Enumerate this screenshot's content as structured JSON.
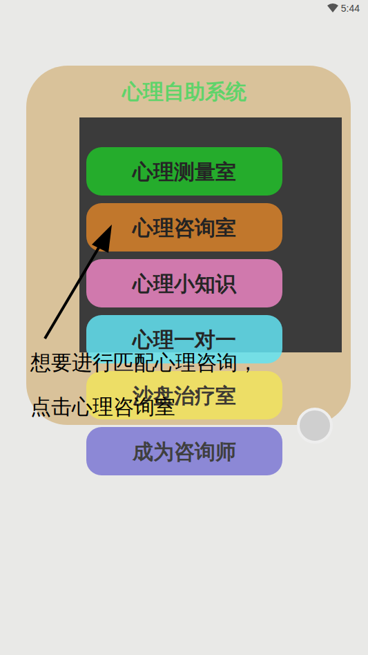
{
  "status_bar": {
    "time": "5:44"
  },
  "title": "心理自助系统",
  "menu": [
    {
      "label": "心理测量室",
      "selected": false,
      "color": "#22c02a"
    },
    {
      "label": "心理咨询室",
      "selected": true,
      "color": "#c97b2c"
    },
    {
      "label": "心理小知识",
      "selected": false,
      "color": "#ea84c2"
    },
    {
      "label": "心理一对一",
      "selected": false,
      "color": "#63e3f3"
    },
    {
      "label": "沙盘治疗室",
      "selected": false,
      "color": "#f1e35e"
    },
    {
      "label": "成为咨询师",
      "selected": false,
      "color": "#7c78d4"
    }
  ],
  "annotation": {
    "lines": [
      "想要进行匹配心理咨询，",
      "点击心理咨询室"
    ]
  }
}
